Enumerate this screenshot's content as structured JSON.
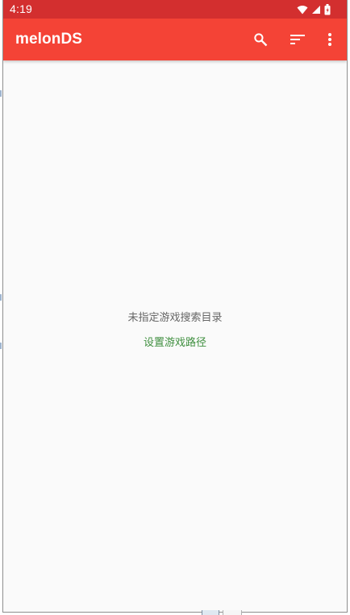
{
  "status_bar": {
    "time": "4:19",
    "icons": [
      "wifi-icon",
      "cell-signal-icon",
      "battery-icon"
    ],
    "background": "#d32f2f"
  },
  "app_bar": {
    "title": "melonDS",
    "background": "#f44336",
    "actions": [
      "search-icon",
      "sort-icon",
      "more-vert-icon"
    ]
  },
  "main": {
    "empty_message": "未指定游戏搜索目录",
    "set_path_link": "设置游戏路径",
    "message_color": "#666666",
    "link_color": "#3f8f3f",
    "background": "#fafafa"
  }
}
